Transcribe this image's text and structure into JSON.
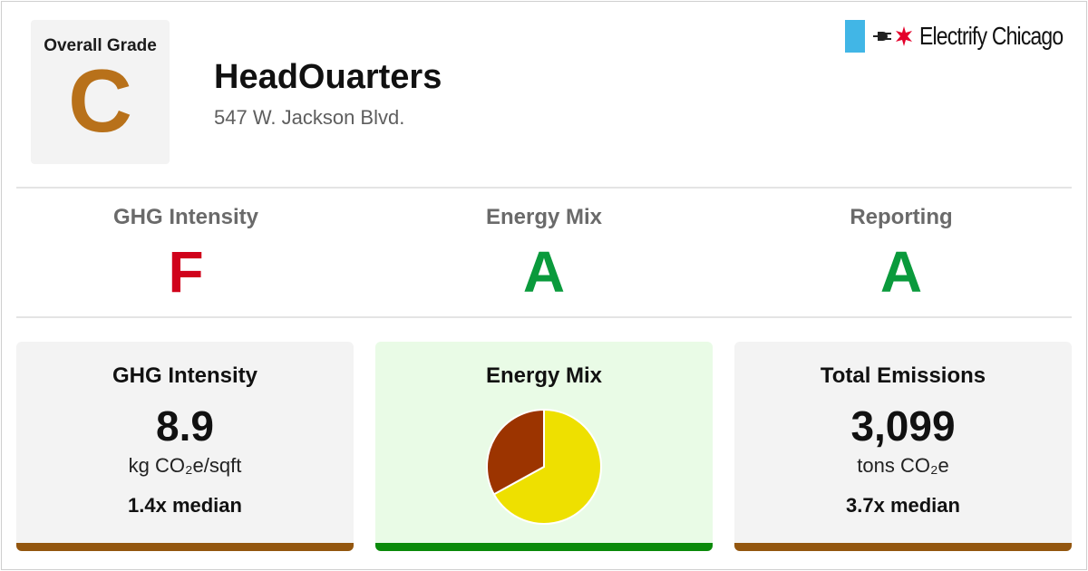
{
  "overall": {
    "label": "Overall Grade",
    "grade": "C",
    "grade_color": "#b8711a"
  },
  "building": {
    "name": "HeadOuarters",
    "address": "547 W. Jackson Blvd."
  },
  "logo": {
    "text": "Electrify Chicago",
    "flag_color": "#41b6e6",
    "star_color": "#e4002b"
  },
  "subgrades": [
    {
      "label": "GHG Intensity",
      "grade": "F",
      "color": "#d0021b"
    },
    {
      "label": "Energy Mix",
      "grade": "A",
      "color": "#0a9a3c"
    },
    {
      "label": "Reporting",
      "grade": "A",
      "color": "#0a9a3c"
    }
  ],
  "cards": {
    "ghg": {
      "title": "GHG Intensity",
      "value": "8.9",
      "unit": "kg CO₂e/sqft",
      "median": "1.4x median",
      "bar_color": "#93560f",
      "bg": "#f3f3f3"
    },
    "mix": {
      "title": "Energy Mix",
      "bar_color": "#0a8a0a",
      "bg": "#e9fbe6"
    },
    "emissions": {
      "title": "Total Emissions",
      "value": "3,099",
      "unit": "tons CO₂e",
      "median": "3.7x median",
      "bar_color": "#93560f",
      "bg": "#f3f3f3"
    }
  },
  "chart_data": {
    "type": "pie",
    "slices": [
      {
        "value": 0.67,
        "color": "#eee000"
      },
      {
        "value": 0.33,
        "color": "#9c3400"
      }
    ]
  }
}
